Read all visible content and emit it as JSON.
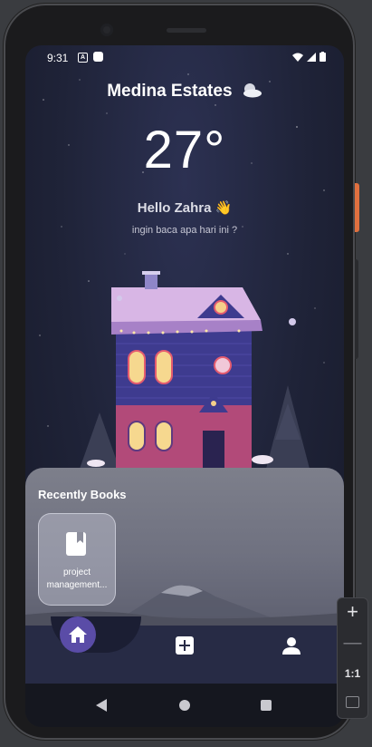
{
  "status_bar": {
    "time": "9:31"
  },
  "header": {
    "location": "Medina Estates",
    "weather_icon": "night-cloud-icon",
    "temperature": "27°"
  },
  "greeting": {
    "hello": "Hello Zahra 👋",
    "prompt": "ingin baca apa hari ini ?"
  },
  "recent_books": {
    "title": "Recently Books",
    "items": [
      {
        "label": "project management..."
      }
    ]
  },
  "bottom_nav": {
    "items": [
      "home-icon",
      "add-icon",
      "person-icon"
    ],
    "active": "home"
  },
  "emulator_controls": {
    "zoom_in": "+",
    "zoom_out": "—",
    "ratio": "1:1"
  },
  "colors": {
    "accent": "#5a4ca7",
    "nav_bg": "#272b45",
    "sky": "#1f2338"
  }
}
